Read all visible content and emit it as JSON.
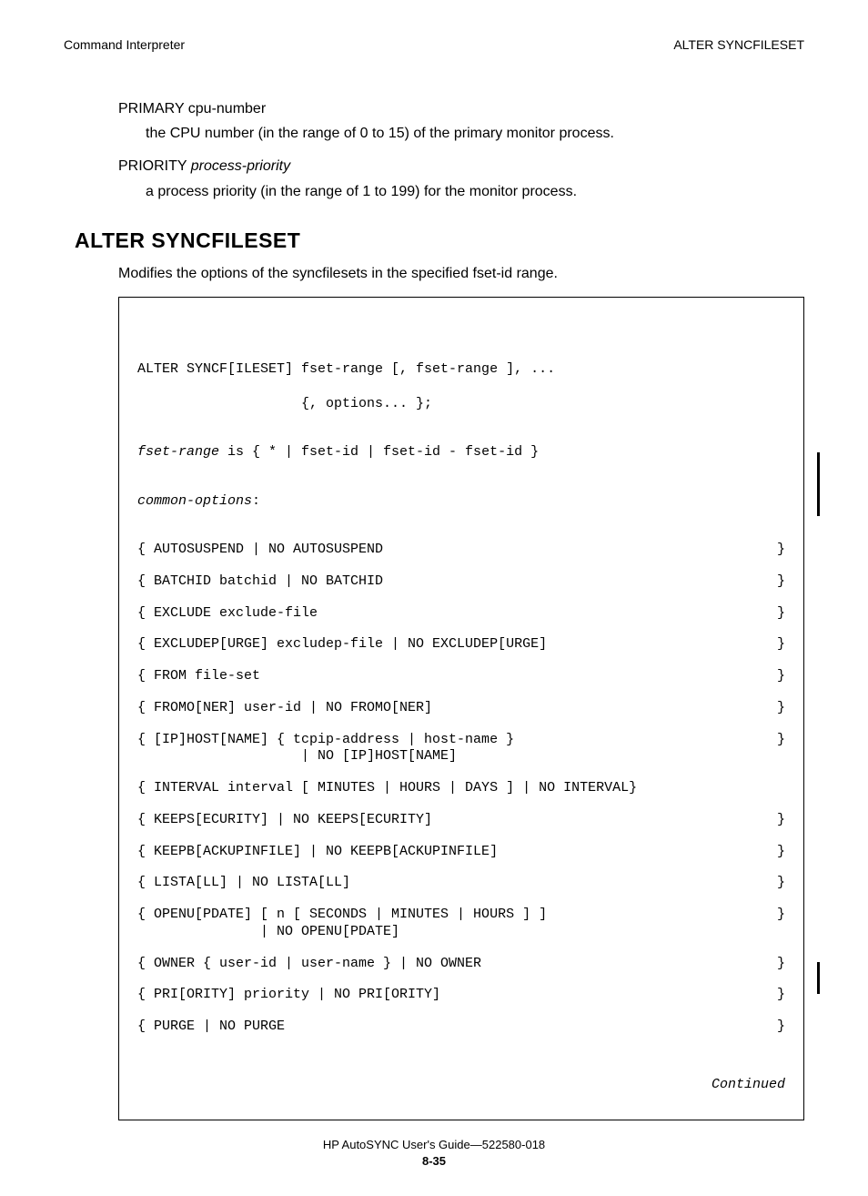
{
  "header": {
    "left": "Command Interpreter",
    "right": "ALTER SYNCFILESET"
  },
  "defs": [
    {
      "term_plain": "PRIMARY cpu-number",
      "term_italic": "",
      "desc": "the CPU number (in the range of 0 to 15) of the primary monitor process."
    },
    {
      "term_plain": "PRIORITY ",
      "term_italic": "process-priority",
      "desc": "a process priority (in the range of 1 to 199) for the monitor process."
    }
  ],
  "section_title": "ALTER SYNCFILESET",
  "intro": "Modifies the options of the syncfilesets in the specified fset-id range.",
  "syntax": {
    "head1": "ALTER SYNCF[ILESET] fset-range [, fset-range ], ...",
    "head2": "                    {, options... };",
    "fset_label": "fset-range",
    "fset_rest": " is { * | fset-id | fset-id - fset-id }",
    "common_label": "common-options",
    "options": [
      "{ AUTOSUSPEND | NO AUTOSUSPEND",
      "{ BATCHID batchid | NO BATCHID",
      "{ EXCLUDE exclude-file",
      "{ EXCLUDEP[URGE] excludep-file | NO EXCLUDEP[URGE]",
      "{ FROM file-set",
      "{ FROMO[NER] user-id | NO FROMO[NER]",
      "{ [IP]HOST[NAME] { tcpip-address | host-name }\n                    | NO [IP]HOST[NAME]",
      "{ INTERVAL interval [ MINUTES | HOURS | DAYS ] | NO INTERVAL}",
      "{ KEEPS[ECURITY] | NO KEEPS[ECURITY]",
      "{ KEEPB[ACKUPINFILE] | NO KEEPB[ACKUPINFILE]",
      "{ LISTA[LL] | NO LISTA[LL]",
      "{ OPENU[PDATE] [ n [ SECONDS | MINUTES | HOURS ] ]\n               | NO OPENU[PDATE]",
      "{ OWNER { user-id | user-name } | NO OWNER",
      "{ PRI[ORITY] priority | NO PRI[ORITY]",
      "{ PURGE | NO PURGE"
    ],
    "closers": [
      "}",
      "}",
      "}",
      "}",
      "}",
      "}",
      "}",
      "",
      "}",
      "}",
      "}",
      "}",
      "}",
      "}",
      "}"
    ],
    "continued": "Continued"
  },
  "footer": {
    "line1": "HP AutoSYNC User's Guide—522580-018",
    "pagenum": "8-35"
  }
}
